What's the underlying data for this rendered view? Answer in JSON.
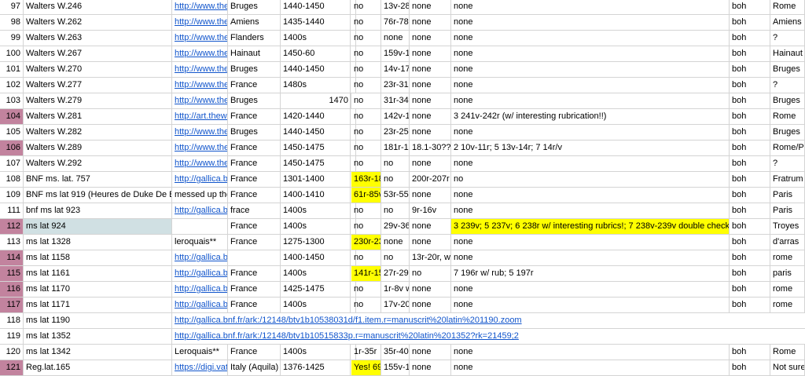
{
  "colors": {
    "highlight_yellow": "#ffff00",
    "row_pink": "#c2839e",
    "cell_bluegrey": "#d0e0e3",
    "link": "#1155cc"
  },
  "rows": [
    {
      "n": "97",
      "name": "Walters W.246",
      "link": "http://www.the",
      "place": "Bruges",
      "date": "1440-1450",
      "e": "",
      "f": "no",
      "g": "13v-28",
      "h": "none",
      "i": "none",
      "j": "boh",
      "k": "Rome"
    },
    {
      "n": "98",
      "name": "Walters W.262",
      "link": "http://www.the",
      "place": "Amiens",
      "date": "1435-1440",
      "e": "",
      "f": "no",
      "g": "76r-78v",
      "h": "none",
      "i": "none",
      "j": "boh",
      "k": "Amiens"
    },
    {
      "n": "99",
      "name": "Walters W.263",
      "link": "http://www.the",
      "place": "Flanders",
      "date": "1400s",
      "e": "",
      "f": "no",
      "g": "none",
      "h": "none",
      "i": "none",
      "j": "boh",
      "k": "?"
    },
    {
      "n": "100",
      "name": "Walters W.267",
      "link": "http://www.the",
      "place": "Hainaut",
      "date": "1450-60",
      "e": "",
      "f": "no",
      "g": "159v-1",
      "h": "none",
      "i": "none",
      "j": "boh",
      "k": "Hainaut"
    },
    {
      "n": "101",
      "name": "Walters W.270",
      "link": "http://www.the",
      "place": "Bruges",
      "date": "1440-1450",
      "e": "",
      "f": "no",
      "g": "14v-17",
      "h": "none",
      "i": "none",
      "j": "boh",
      "k": "Bruges"
    },
    {
      "n": "102",
      "name": "Walters W.277",
      "link": "http://www.the",
      "place": "France",
      "date": "1480s",
      "e": "",
      "f": "no",
      "g": "23r-31r",
      "h": "none",
      "i": "none",
      "j": "boh",
      "k": "?"
    },
    {
      "n": "103",
      "name": "Walters W.279",
      "link": "http://www.the",
      "place": "Bruges",
      "date": "",
      "e": "1470",
      "f": "no",
      "g": "31r-34v",
      "h": "none",
      "i": "none",
      "j": "boh",
      "k": "Bruges"
    },
    {
      "n": "104",
      "name": "Walters W.281",
      "link": "http://art.thewa",
      "place": "France",
      "date": "1420-1440",
      "e": "",
      "f": "no",
      "g": "142v-1",
      "h": "none",
      "i": "3 241v-242r (w/ interesting rubrication!!)",
      "j": "boh",
      "k": "Rome",
      "pink": true
    },
    {
      "n": "105",
      "name": "Walters W.282",
      "link": "http://www.the",
      "place": "Bruges",
      "date": "1440-1450",
      "e": "",
      "f": "no",
      "g": "23r-25v",
      "h": "none",
      "i": "none",
      "j": "boh",
      "k": "Bruges"
    },
    {
      "n": "106",
      "name": "Walters W.289",
      "link": "http://www.the",
      "place": "France",
      "date": "1450-1475",
      "e": "",
      "f": "no",
      "g": "181r-18",
      "h": "18.1-30??",
      "i": "2 10v-11r; 5 13v-14r; 7 14r/v",
      "j": "boh",
      "k": "Rome/Paris",
      "pink": true
    },
    {
      "n": "107",
      "name": "Walters W.292",
      "link": "http://www.the",
      "place": "France",
      "date": "1450-1475",
      "e": "",
      "f": "no",
      "g": "no",
      "h": "none",
      "i": "none",
      "j": "boh",
      "k": "?"
    },
    {
      "n": "108",
      "name": "BNF ms. lat. 757",
      "link": "http://gallica.b",
      "place": "France",
      "date": "1301-1400",
      "e": "",
      "f": "163r-18",
      "fhl": true,
      "g": "no",
      "h": "200r-207r",
      "i": "no",
      "j": "boh",
      "k": "Fratrum Min"
    },
    {
      "n": "109",
      "name": "BNF ms lat 919 (Heures de Duke De B",
      "namespan": true,
      "link": "messed up the",
      "linkplain": true,
      "place": "France",
      "date": "1400-1410",
      "e": "",
      "f": "61r-85v",
      "fhl": true,
      "g": "53r-55r",
      "h": "none",
      "i": "none",
      "j": "boh",
      "k": "Paris"
    },
    {
      "n": "111",
      "name": "bnf ms lat 923",
      "link": "http://gallica.b",
      "place": "frace",
      "date": "1400s",
      "e": "",
      "f": "no",
      "g": "no",
      "h": "9r-16v",
      "i": "none",
      "j": "boh",
      "k": "Paris"
    },
    {
      "n": "112",
      "name": "ms lat 924",
      "namebg": true,
      "link": "",
      "place": "France",
      "date": "1400s",
      "e": "",
      "f": "no",
      "g": "29v-36",
      "h": "none",
      "i": "3 239v; 5 237v; 6 238r w/ interesting rubrics!; 7 238v-239v double check",
      "ihl": true,
      "j": "boh",
      "k": "Troyes",
      "pink": true
    },
    {
      "n": "113",
      "name": "ms lat 1328",
      "link": "leroquais**",
      "linkplain": true,
      "place": "France",
      "date": "1275-1300",
      "e": "",
      "f": "230r-23",
      "fhl": true,
      "g": "none",
      "h": "none",
      "i": "none",
      "j": "boh",
      "k": "d'arras"
    },
    {
      "n": "114",
      "name": "ms lat 1158",
      "link": "http://gallica.b",
      "place": "",
      "date": "1400-1450",
      "e": "",
      "f": "no",
      "g": "no",
      "h": "13r-20r, wi",
      "i": "none",
      "j": "boh",
      "k": "rome",
      "pink": true
    },
    {
      "n": "115",
      "name": "ms lat 1161",
      "link": "http://gallica.b",
      "place": "France",
      "date": "1400s",
      "e": "",
      "f": "141r-15",
      "fhl": true,
      "g": "27r-29r",
      "h": "no",
      "i": "7 196r w/ rub; 5 197r",
      "j": "boh",
      "k": "paris",
      "pink": true
    },
    {
      "n": "116",
      "name": "ms lat 1170",
      "link": "http://gallica.b",
      "place": "France",
      "date": "1425-1475",
      "e": "",
      "f": "no",
      "g": "1r-8v with",
      "h": "none",
      "i": "none",
      "j": "boh",
      "k": "rome",
      "pink": true
    },
    {
      "n": "117",
      "name": "ms lat 1171",
      "link": "http://gallica.b",
      "place": "France",
      "date": "1400s",
      "e": "",
      "f": "no",
      "g": "17v-20r",
      "h": "none",
      "i": "none",
      "j": "boh",
      "k": "rome",
      "pink": true
    },
    {
      "n": "118",
      "name": "ms lat 1190",
      "fulllink": "http://gallica.bnf.fr/ark:/12148/btv1b10538031d/f1.item.r=manuscrit%20latin%201190.zoom"
    },
    {
      "n": "119",
      "name": "ms lat 1352",
      "fulllink": "http://gallica.bnf.fr/ark:/12148/btv1b10515833p.r=manuscrit%20latin%201352?rk=21459;2"
    },
    {
      "n": "120",
      "name": "ms lat 1342",
      "link": "Leroquais**",
      "linkplain": true,
      "place": "France",
      "date": "1400s",
      "e": "",
      "f": "1r-35r",
      "g": "35r-40r",
      "h": "none",
      "i": "none",
      "j": "boh",
      "k": "Rome"
    },
    {
      "n": "121",
      "name": "Reg.lat.165",
      "link": "https://digi.vat",
      "place": "Italy (Aquila)",
      "date": "1376-1425",
      "e": "",
      "f": "Yes! 69",
      "fhl": true,
      "g": "155v-1",
      "h": "none",
      "i": "none",
      "j": "boh",
      "k": "Not sure, bu",
      "pink": true
    }
  ]
}
